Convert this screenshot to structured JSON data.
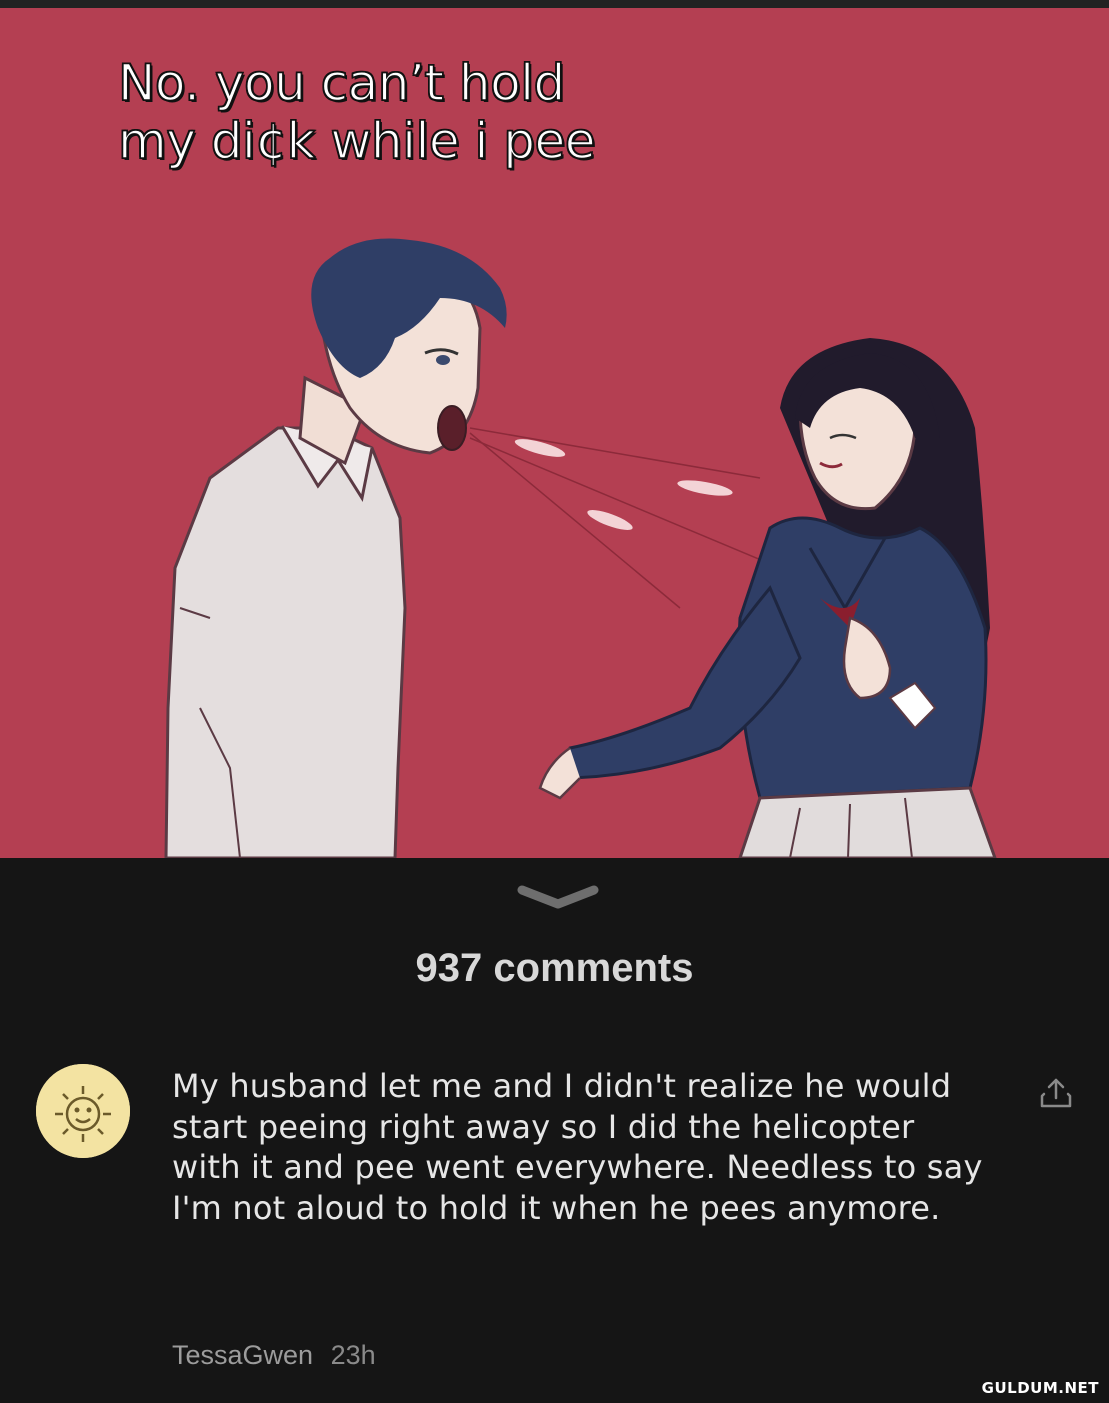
{
  "meme": {
    "caption_line1": "No. you can’t hold",
    "caption_line2": "my di¢k while i pee",
    "background_color": "#b43f52"
  },
  "comments": {
    "expand_icon": "chevron-down-icon",
    "count_label": "937 comments"
  },
  "comment": {
    "avatar_icon": "sun-face-avatar",
    "text": "My husband let me and I didn't realize he would start peeing right away so I did the helicopter with it and pee went everywhere. Needless to say I'm not aloud to hold it when he pees anymore.",
    "author": "TessaGwen",
    "time": "23h",
    "share_icon": "share-icon"
  },
  "watermark": "GULDUM.NET"
}
